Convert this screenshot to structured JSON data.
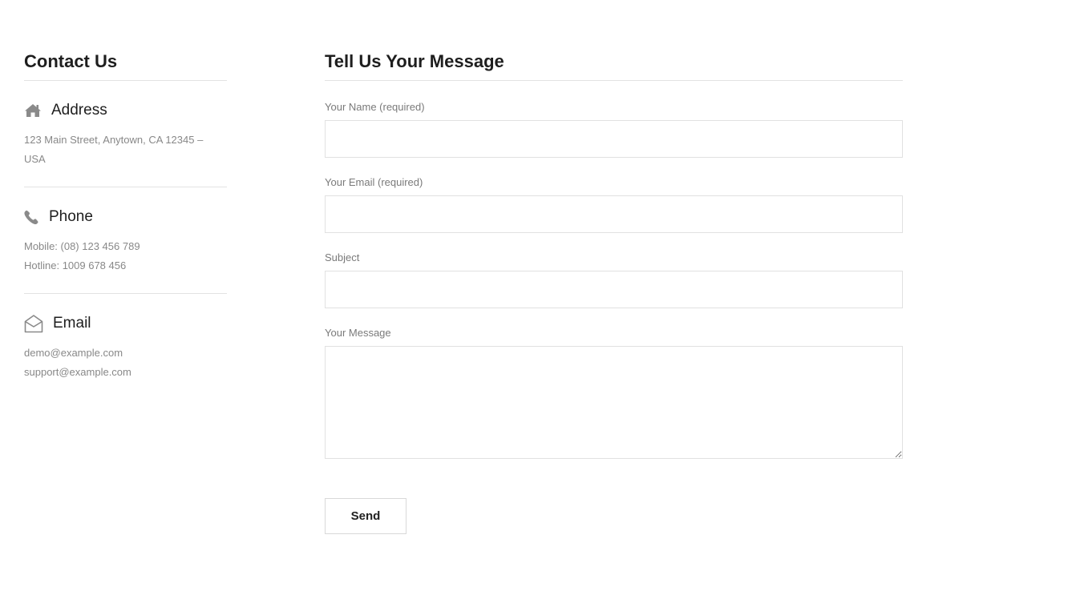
{
  "contact": {
    "heading": "Contact Us",
    "address": {
      "icon": "home-icon",
      "title": "Address",
      "line1": "123 Main Street, Anytown, CA 12345 –",
      "line2": "USA"
    },
    "phone": {
      "icon": "phone-icon",
      "title": "Phone",
      "mobile": "Mobile: (08) 123 456 789",
      "hotline": "Hotline: 1009 678 456"
    },
    "email": {
      "icon": "envelope-open-icon",
      "title": "Email",
      "primary": "demo@example.com",
      "support": "support@example.com"
    }
  },
  "form": {
    "heading": "Tell Us Your Message",
    "name": {
      "label": "Your Name (required)",
      "value": ""
    },
    "email": {
      "label": "Your Email (required)",
      "value": ""
    },
    "subject": {
      "label": "Subject",
      "value": ""
    },
    "message": {
      "label": "Your Message",
      "value": ""
    },
    "submit_label": "Send"
  },
  "colors": {
    "heading": "#1e1e1e",
    "muted_text": "#888888",
    "icon": "#8a8a8a",
    "border": "#e1e1e1"
  }
}
